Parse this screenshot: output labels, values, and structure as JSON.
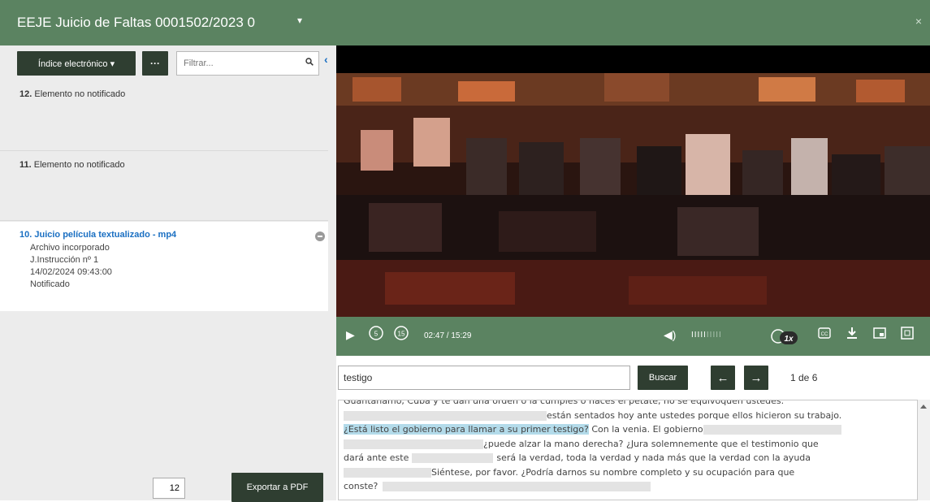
{
  "window": {
    "title": "EEJE Juicio de Faltas 0001502/2023 0",
    "caret": "▾",
    "close": "×"
  },
  "sidebar": {
    "index_button": "Índice electrónico ▾",
    "more_button": "···",
    "filter_placeholder": "Filtrar...",
    "collapse": "‹",
    "items": [
      {
        "num": "12.",
        "label": "Elemento no notificado"
      },
      {
        "num": "11.",
        "label": "Elemento no notificado"
      },
      {
        "num": "10.",
        "label": "Juicio película textualizado - mp4",
        "meta": [
          "Archivo incorporado",
          "J.Instrucción nº 1",
          "14/02/2024 09:43:00",
          "Notificado"
        ]
      }
    ],
    "page_value": "12",
    "export_button": "Exportar a PDF"
  },
  "player": {
    "time": "02:47 / 15:29",
    "speed": "1x",
    "rewind_seconds": "5",
    "forward_seconds": "15",
    "volume_level": 0.5
  },
  "search": {
    "value": "testigo",
    "button": "Buscar",
    "prev": "←",
    "next": "→",
    "count": "1 de 6"
  },
  "transcript": {
    "line1": "Guantánamo, Cuba y te dan una orden o la cumples o haces el petate, no se equivoquen ustedes.",
    "line2": "están sentados hoy ante ustedes porque ellos hicieron su trabajo.",
    "line3_highlight": "¿Está listo el gobierno para llamar a su primer testigo?",
    "line3_rest": " Con la venia. El gobierno",
    "line4": "¿puede alzar la mano derecha? ¿Jura solemnemente que el testimonio que",
    "line5_a": "dará ante este",
    "line5_b": "será la verdad, toda la verdad y nada más que la verdad con la ayuda",
    "line6": "Siéntese, por favor. ¿Podría darnos su nombre completo y su ocupación para que",
    "line7": "conste?"
  },
  "colors": {
    "header_green": "#5b8361",
    "dark_button": "#2f3e31",
    "link_blue": "#1a6fc2",
    "highlight": "#b3dbea"
  }
}
